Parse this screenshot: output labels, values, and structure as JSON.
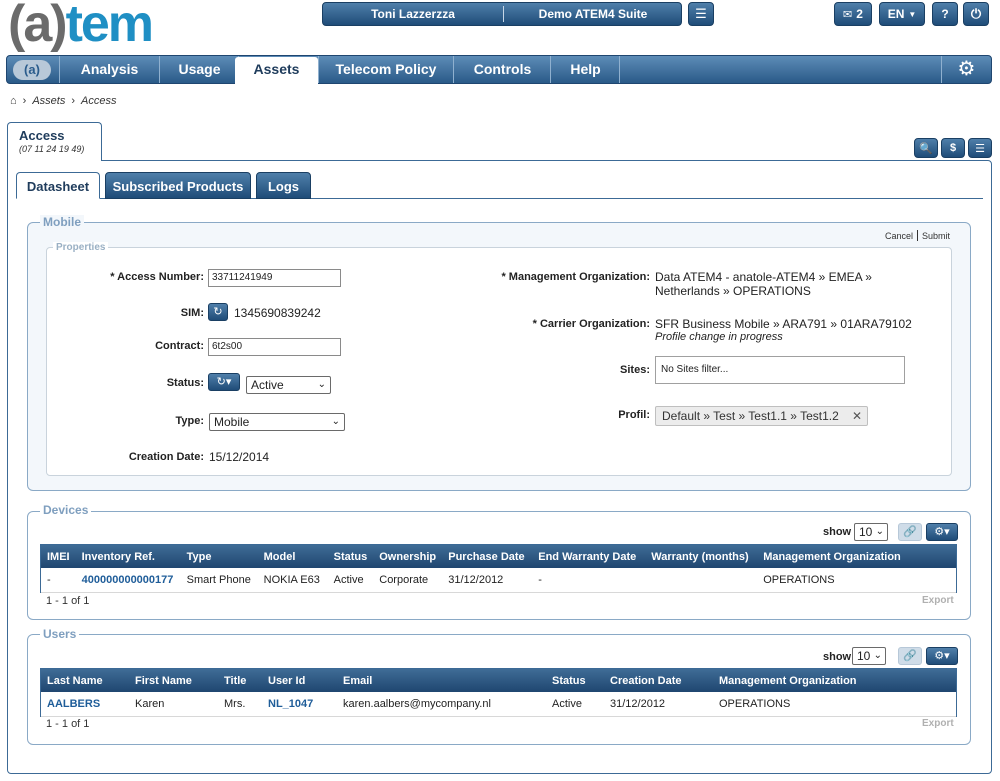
{
  "header": {
    "logo_text_left": "(a)",
    "logo_text_right": "tem",
    "user_name": "Toni Lazzerzza",
    "suite_name": "Demo ATEM4 Suite",
    "messages_count": "2",
    "language": "EN",
    "help_label": "?"
  },
  "nav": {
    "logo": "(a)",
    "items": [
      {
        "label": "Analysis"
      },
      {
        "label": "Usage"
      },
      {
        "label": "Assets"
      },
      {
        "label": "Telecom Policy"
      },
      {
        "label": "Controls"
      },
      {
        "label": "Help"
      }
    ],
    "active": "Assets"
  },
  "breadcrumb": {
    "items": [
      "Assets",
      "Access"
    ]
  },
  "page_tab": {
    "title": "Access",
    "subtitle": "(07 11 24 19 49)"
  },
  "inner_tabs": [
    {
      "label": "Datasheet"
    },
    {
      "label": "Subscribed Products"
    },
    {
      "label": "Logs"
    }
  ],
  "mobile": {
    "legend": "Mobile",
    "properties_legend": "Properties",
    "cancel_label": "Cancel",
    "submit_label": "Submit",
    "access_number_label": "* Access Number:",
    "access_number": "33711241949",
    "sim_label": "SIM:",
    "sim_value": "1345690839242",
    "contract_label": "Contract:",
    "contract_value": "6t2s00",
    "status_label": "Status:",
    "status_value": "Active",
    "type_label": "Type:",
    "type_value": "Mobile",
    "creation_date_label": "Creation Date:",
    "creation_date": "15/12/2014",
    "mgmt_org_label": "* Management Organization:",
    "mgmt_org_line1": "Data ATEM4 - anatole-ATEM4 » EMEA »",
    "mgmt_org_line2": "Netherlands » OPERATIONS",
    "carrier_org_label": "* Carrier Organization:",
    "carrier_org": "SFR Business Mobile » ARA791 » 01ARA79102",
    "carrier_note": "Profile change in progress",
    "sites_label": "Sites:",
    "sites_placeholder": "No Sites filter...",
    "profil_label": "Profil:",
    "profil_value": "Default » Test » Test1.1 » Test1.2"
  },
  "devices": {
    "legend": "Devices",
    "show_label": "show",
    "show_value": "10",
    "columns": [
      "IMEI",
      "Inventory Ref.",
      "Type",
      "Model",
      "Status",
      "Ownership",
      "Purchase Date",
      "End Warranty Date",
      "Warranty (months)",
      "Management Organization"
    ],
    "rows": [
      [
        "-",
        "400000000000177",
        "Smart Phone",
        "NOKIA E63",
        "Active",
        "Corporate",
        "31/12/2012",
        "-",
        "",
        "OPERATIONS"
      ]
    ],
    "pager": "1 - 1 of 1",
    "export_label": "Export"
  },
  "users": {
    "legend": "Users",
    "show_label": "show",
    "show_value": "10",
    "columns": [
      "Last Name",
      "First Name",
      "Title",
      "User Id",
      "Email",
      "Status",
      "Creation Date",
      "Management Organization"
    ],
    "rows": [
      [
        "AALBERS",
        "Karen",
        "Mrs.",
        "NL_1047",
        "karen.aalbers@mycompany.nl",
        "Active",
        "31/12/2012",
        "OPERATIONS"
      ]
    ],
    "pager": "1 - 1 of 1",
    "export_label": "Export"
  }
}
